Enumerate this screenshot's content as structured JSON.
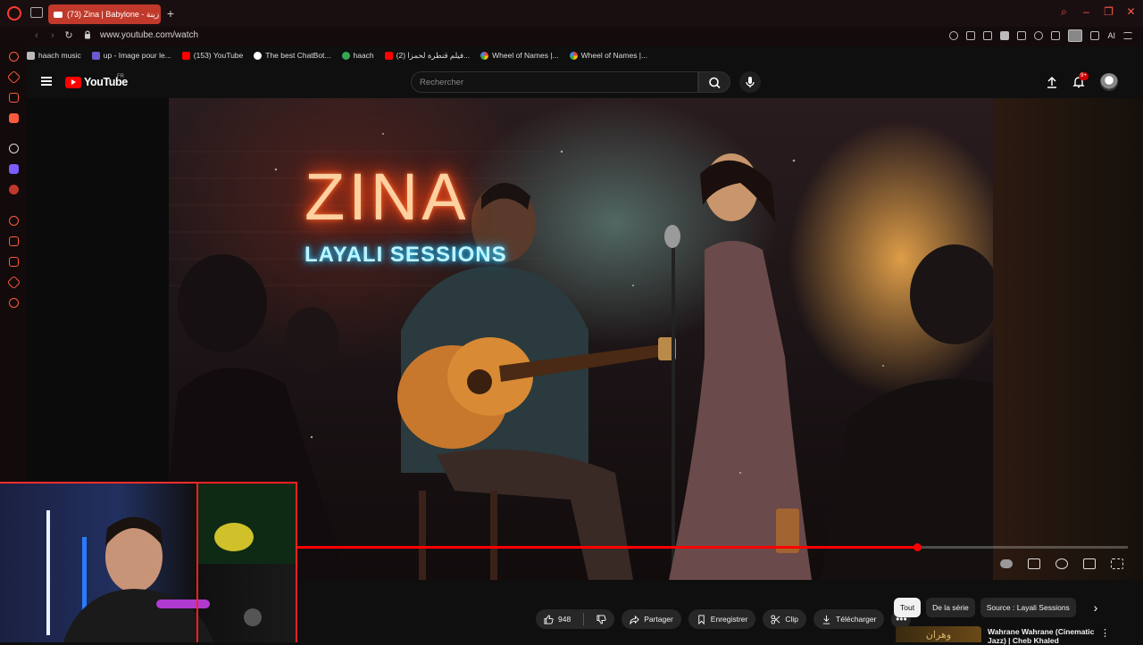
{
  "browser": {
    "active_tab_title": "(73) Zina | Babylone - زينة",
    "url": "www.youtube.com/watch",
    "aria_label": "AI",
    "bookmarks": [
      {
        "label": "haach music",
        "color": "#d9d9d9"
      },
      {
        "label": "up - Image pour le...",
        "color": "#6a5acd"
      },
      {
        "label": "(153) YouTube",
        "color": "#ff0000"
      },
      {
        "label": "The best ChatBot...",
        "color": "#ffffff"
      },
      {
        "label": "haach",
        "color": "#34a853"
      },
      {
        "label": "(2) فيلم قنطرة لحمزا...",
        "color": "#ff0000"
      },
      {
        "label": "Wheel of Names |...",
        "color": "#4285f4"
      },
      {
        "label": "Wheel of Names |...",
        "color": "#4285f4"
      }
    ]
  },
  "youtube": {
    "logo_text": "YouTube",
    "country_code": "FR",
    "search_placeholder": "Rechercher",
    "notification_count": "9+"
  },
  "video": {
    "neon_title": "ZINA",
    "neon_subtitle": "LAYALI SESSIONS",
    "progress_fraction": 0.78
  },
  "actions": {
    "like_count": "948",
    "share": "Partager",
    "save": "Enregistrer",
    "clip": "Clip",
    "download": "Télécharger"
  },
  "chips": [
    "Tout",
    "De la série",
    "Source : Layali Sessions"
  ],
  "recommendation": {
    "title": "Wahrane Wahrane (Cinematic Jazz) | Cheb Khaled",
    "thumb_text": "وهران"
  },
  "colors": {
    "accent": "#ff0000",
    "opera_red": "#ff3b30",
    "tab_active": "#c0392b"
  }
}
